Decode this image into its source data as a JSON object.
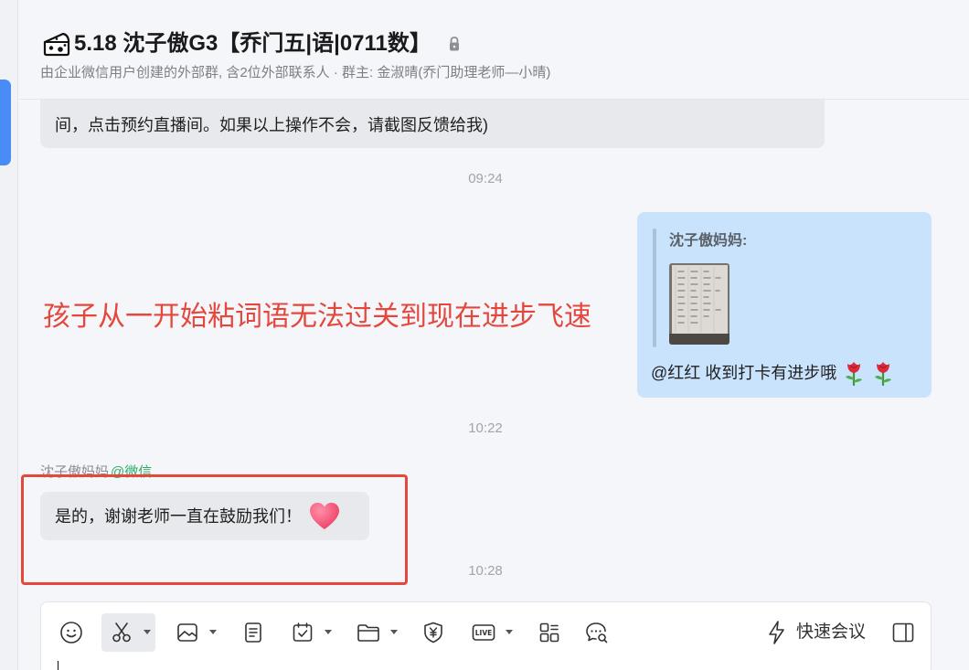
{
  "colors": {
    "accent_blue": "#4a8cf6",
    "chat_background": "#f5f6fa",
    "received_bubble": "#e7e9ed",
    "sent_bubble": "#c9e3fd",
    "annotation_red": "#e5473c",
    "wechat_source_green": "#2aae67"
  },
  "header": {
    "group_icon": "cheese-group-icon",
    "title": "5.18 沈子傲G3【乔门五|语|0711数】",
    "lock_icon": "lock-icon",
    "subtitle": "由企业微信用户创建的外部群, 含2位外部联系人 · 群主: 金淑晴(乔门助理老师—小晴)"
  },
  "messages": [
    {
      "kind": "received",
      "text": "间，点击预约直播间。如果以上操作不会，请截图反馈给我)"
    },
    {
      "kind": "timestamp",
      "text": "09:24"
    },
    {
      "kind": "sent",
      "quote_author": "沈子傲妈妈:",
      "quote_image_icon": "notebook-photo-thumbnail",
      "text": "@红红 收到打卡有进步哦",
      "emoji": [
        "rose-emoji-icon",
        "rose-emoji-icon"
      ]
    },
    {
      "kind": "timestamp",
      "text": "10:22"
    },
    {
      "kind": "received",
      "sender": "沈子傲妈妈",
      "sender_source": "@微信",
      "text": "是的，谢谢老师一直在鼓励我们！",
      "emoji": [
        "heart-emoji-icon"
      ]
    },
    {
      "kind": "timestamp",
      "text": "10:28"
    }
  ],
  "annotations": {
    "overlay_text": "孩子从一开始粘词语无法过关到现在进步飞速"
  },
  "composer": {
    "toolbar_icons": [
      "smiley-icon",
      "scissors-icon",
      "image-icon",
      "document-icon",
      "calendar-check-icon",
      "folder-icon",
      "yuan-shield-icon",
      "live-icon",
      "apps-grid-icon",
      "chat-search-icon",
      "lightning-icon",
      "sidebar-toggle-icon"
    ],
    "live_badge": "LIVE",
    "quick_meeting_label": "快速会议",
    "input_value": ""
  }
}
